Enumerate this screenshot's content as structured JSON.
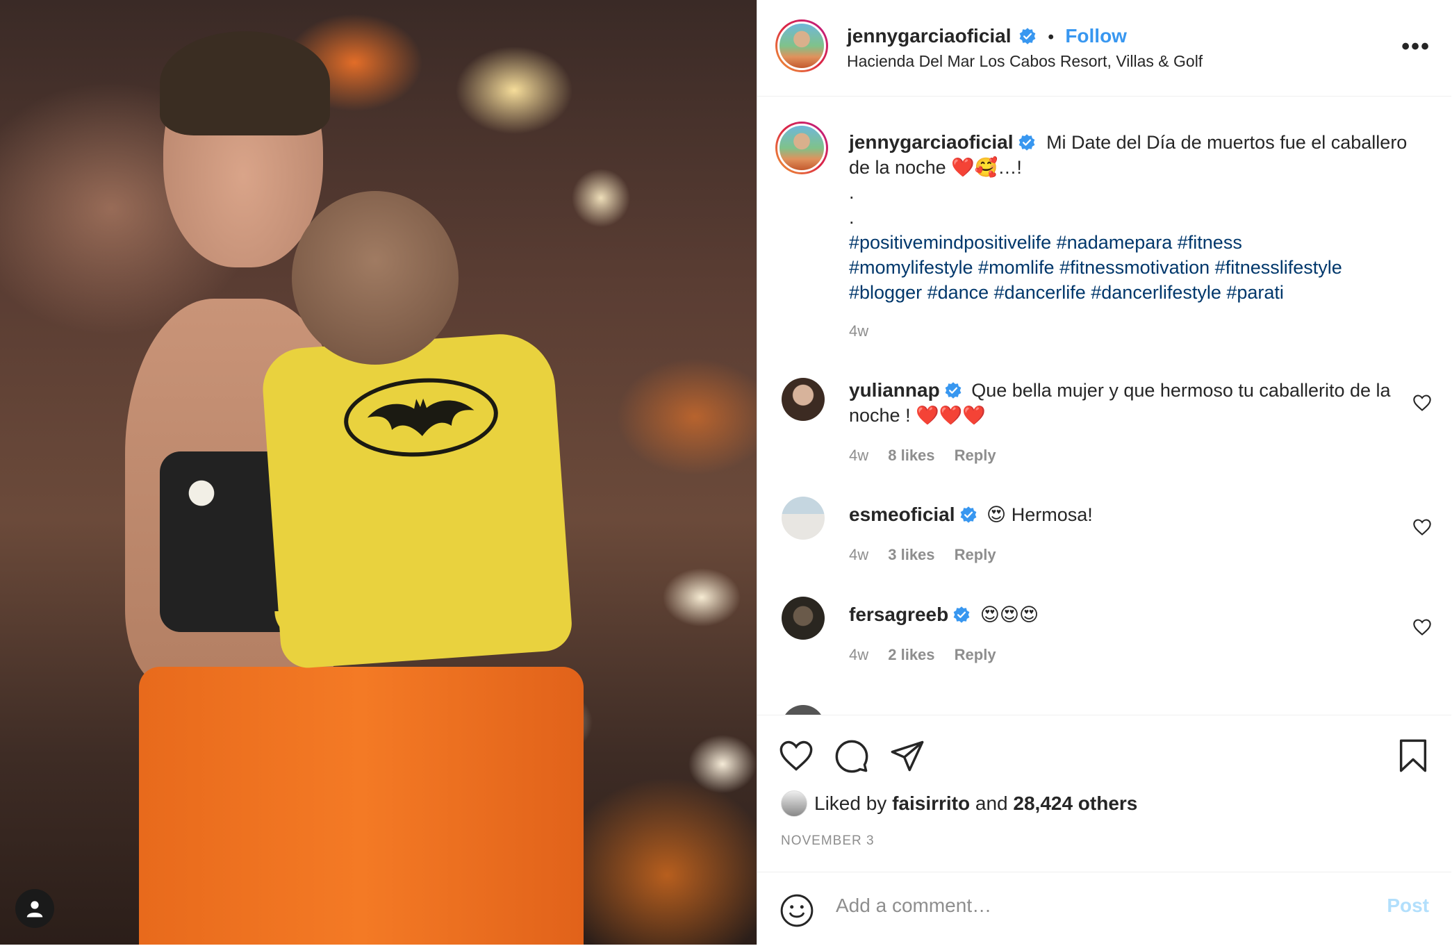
{
  "post": {
    "username": "jennygarciaoficial",
    "follow_label": "Follow",
    "separator": "•",
    "location": "Hacienda Del Mar Los Cabos Resort, Villas & Golf",
    "more_label": "•••",
    "caption_text": "Mi Date del Día de muertos fue el caballero de la noche ❤️🥰…!",
    "caption_dot1": ".",
    "caption_dot2": ".",
    "hashtags_line1": "#positivemindpositivelife #nadamepara #fitness",
    "hashtags_line2": "#momylifestyle #momlife #fitnessmotivation #fitnesslifestyle",
    "hashtags_line3": "#blogger #dance #dancerlife #dancerlifestyle #parati",
    "caption_time": "4w"
  },
  "comments": [
    {
      "username": "yuliannap",
      "text": "Que bella mujer y que hermoso tu caballerito de la noche ! ❤️❤️❤️",
      "time": "4w",
      "likes": "8 likes",
      "reply": "Reply"
    },
    {
      "username": "esmeoficial",
      "text": "😍 Hermosa!",
      "time": "4w",
      "likes": "3 likes",
      "reply": "Reply"
    },
    {
      "username": "fersagreeb",
      "text": "😍😍😍",
      "time": "4w",
      "likes": "2 likes",
      "reply": "Reply"
    }
  ],
  "likes": {
    "prefix": "Liked by",
    "liker": "faisirrito",
    "conj": "and",
    "others": "28,424 others"
  },
  "date": "NOVEMBER 3",
  "add_comment": {
    "placeholder": "Add a comment…",
    "post_label": "Post"
  },
  "colors": {
    "link_blue": "#3897f0",
    "hashtag": "#00376b",
    "verified": "#3897f0",
    "muted": "#8e8e8e"
  }
}
